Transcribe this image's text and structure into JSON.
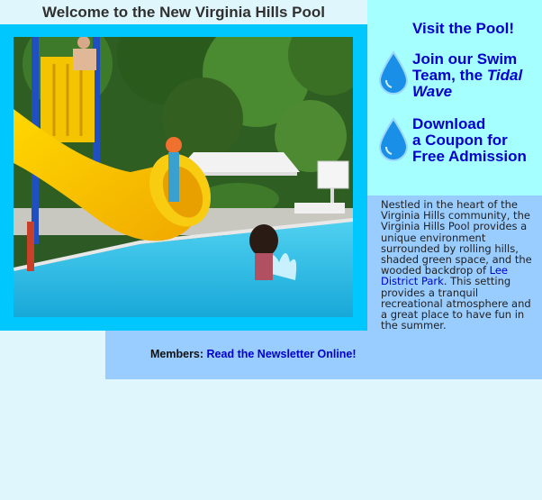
{
  "page": {
    "title": "Welcome to the New Virginia Hills Pool"
  },
  "sidebar": {
    "visit_link": "Visit the Pool!",
    "swim_team": {
      "prefix": "Join our Swim Team, the ",
      "name": "Tidal Wave"
    },
    "coupon": {
      "line1": "Download",
      "line2": "a Coupon for",
      "line3": "Free Admission"
    }
  },
  "description": {
    "before_link": "Nestled in the heart of the Virginia Hills community, the Virginia Hills Pool provides a unique environment surrounded by rolling hills, shaded green space, and the wooded backdrop of ",
    "link": "Lee District Park",
    "after_link": ". This setting provides a tranquil recreational atmosphere and a great place to have fun in the summer."
  },
  "members": {
    "label": "Members:",
    "link": "Read the Newsletter Online!"
  },
  "colors": {
    "page_bg": "#e0f6fd",
    "frame": "#00c8ff",
    "right_panel": "#a6ffff",
    "desc_panel": "#99ccff",
    "link": "#0000cc",
    "drop": "#1a8fe8"
  },
  "icons": {
    "drop": "water-drop-icon"
  }
}
